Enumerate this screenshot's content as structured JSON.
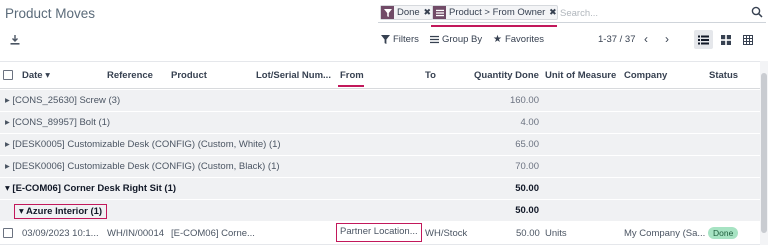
{
  "page": {
    "title": "Product Moves"
  },
  "search": {
    "facets": [
      {
        "icon": "filter-icon",
        "label": "Done"
      },
      {
        "icon": "group-by-icon",
        "label": "Product > From Owner"
      }
    ],
    "placeholder": "Search..."
  },
  "toolbar": {
    "filters": "Filters",
    "group_by": "Group By",
    "favorites": "Favorites",
    "pager": "1-37 / 37",
    "prev": "‹",
    "next": "›",
    "views": [
      "list-view-icon",
      "kanban-view-icon",
      "pivot-view-icon"
    ]
  },
  "table": {
    "columns": [
      "Date ▾",
      "Reference",
      "Product",
      "Lot/Serial Num...",
      "From",
      "To",
      "Quantity Done",
      "Unit of Measure",
      "Company",
      "Status"
    ],
    "groups": [
      {
        "label": "▸ [CONS_25630] Screw (3)",
        "value": "160.00"
      },
      {
        "label": "▸ [CONS_89957] Bolt (1)",
        "value": "4.00"
      },
      {
        "label": "▸ [DESK0005] Customizable Desk (CONFIG) (Custom, White) (1)",
        "value": "65.00"
      },
      {
        "label": "▸ [DESK0006] Customizable Desk (CONFIG) (Custom, Black) (1)",
        "value": "70.00"
      },
      {
        "label": "▾ [E-COM06] Corner Desk Right Sit (1)",
        "value": "50.00"
      },
      {
        "label": "▾ Azure Interior (1)",
        "value": "50.00"
      }
    ],
    "row": {
      "date": "03/09/2023 10:1...",
      "reference": "WH/IN/00014",
      "product": "[E-COM06] Corne...",
      "from": "Partner Location...",
      "to": "WH/Stock",
      "quantity": "50.00",
      "uom": "Units",
      "company": "My Company (Sa...",
      "status": "Done"
    }
  },
  "colors": {
    "brand": "#714b67",
    "highlight": "#c2185b",
    "done_badge": "#a7e3c3"
  }
}
